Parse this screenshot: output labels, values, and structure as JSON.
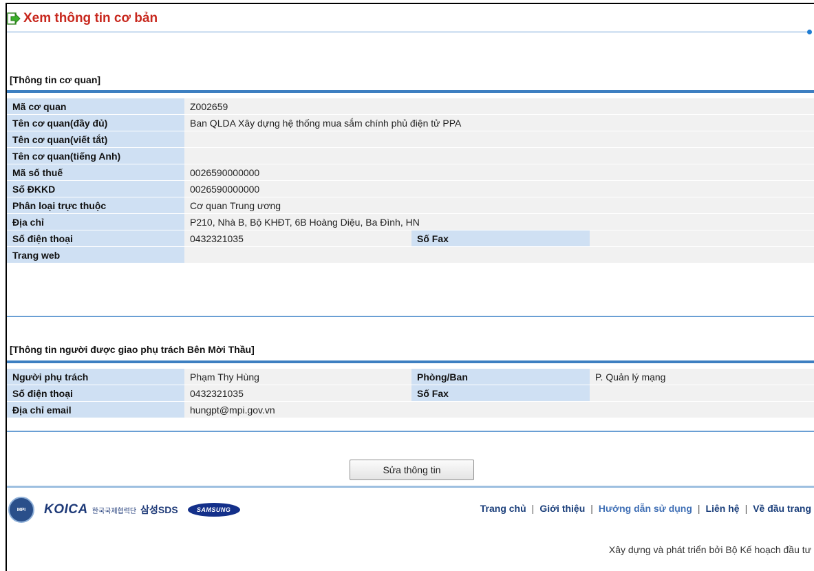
{
  "page": {
    "title": "Xem thông tin cơ bản"
  },
  "agency_section": {
    "title": "[Thông tin cơ quan]",
    "rows": [
      {
        "label": "Mã cơ quan",
        "value": "Z002659"
      },
      {
        "label": "Tên cơ quan(đầy đủ)",
        "value": "Ban QLDA Xây dựng hệ thống mua sắm chính phủ điện tử PPA"
      },
      {
        "label": "Tên cơ quan(viết tắt)",
        "value": ""
      },
      {
        "label": "Tên cơ quan(tiếng Anh)",
        "value": ""
      },
      {
        "label": "Mã số thuế",
        "value": "0026590000000"
      },
      {
        "label": "Số ĐKKD",
        "value": "0026590000000"
      },
      {
        "label": "Phân loại trực thuộc",
        "value": "Cơ quan Trung ương"
      },
      {
        "label": "Địa chỉ",
        "value": "P210, Nhà B, Bộ KHĐT, 6B Hoàng Diệu, Ba Đình, HN"
      }
    ],
    "phone": {
      "label": "Số điện thoại",
      "value": "0432321035",
      "fax_label": "Số Fax",
      "fax_value": ""
    },
    "website": {
      "label": "Trang web",
      "value": ""
    }
  },
  "contact_section": {
    "title": "[Thông tin người được giao phụ trách Bên Mời Thầu]",
    "person": {
      "label": "Người phụ trách",
      "value": "Phạm Thy Hùng",
      "dept_label": "Phòng/Ban",
      "dept_value": "P. Quản lý mạng"
    },
    "phone": {
      "label": "Số điện thoại",
      "value": "0432321035",
      "fax_label": "Số Fax",
      "fax_value": ""
    },
    "email": {
      "label": "Địa chỉ email",
      "value": "hungpt@mpi.gov.vn"
    }
  },
  "actions": {
    "edit_label": "Sửa thông tin"
  },
  "footer": {
    "logos": {
      "seal": "MPI",
      "koica": "KOICA",
      "koica_sub": "한국국제협력단",
      "sds": "삼성SDS",
      "samsung": "SAMSUNG"
    },
    "nav": {
      "home": "Trang chủ",
      "about": "Giới thiệu",
      "guide": "Hướng dẫn sử dụng",
      "contact": "Liên hệ",
      "top": "Về đầu trang",
      "separator": "|"
    },
    "credit": "Xây dựng và phát triển bởi Bộ Kế hoạch đầu tư"
  },
  "colors": {
    "title": "#c8281e",
    "label_bg": "#cfe0f3",
    "value_bg": "#f1f1f1",
    "rule": "#3d7fc1",
    "link": "#1a3e7a"
  }
}
